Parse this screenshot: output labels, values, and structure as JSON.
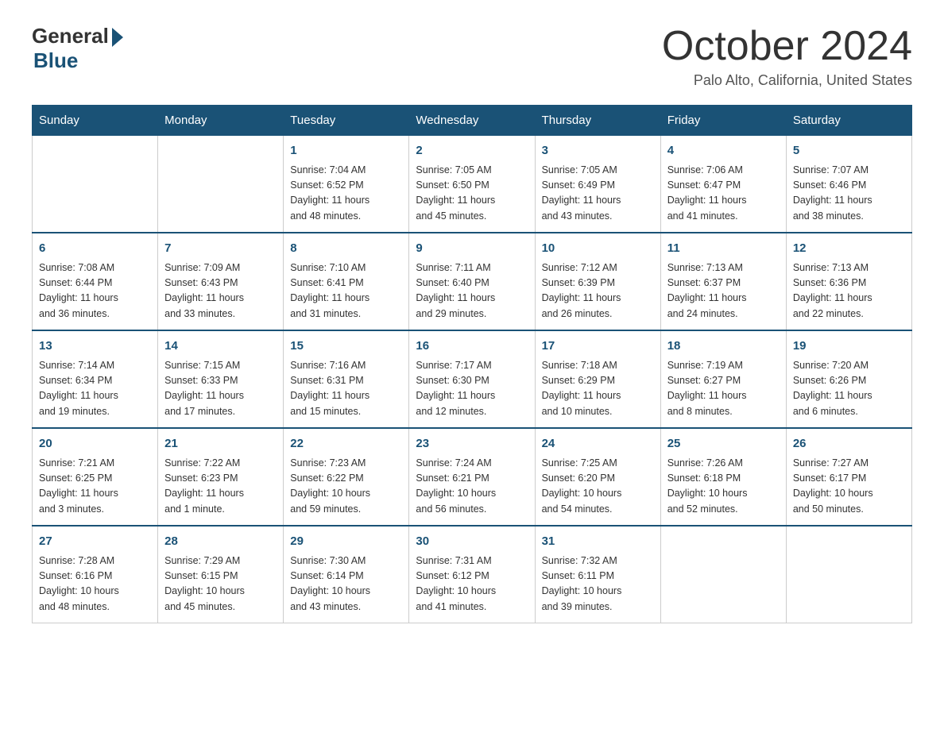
{
  "header": {
    "logo_general": "General",
    "logo_blue": "Blue",
    "month_title": "October 2024",
    "location": "Palo Alto, California, United States"
  },
  "days_of_week": [
    "Sunday",
    "Monday",
    "Tuesday",
    "Wednesday",
    "Thursday",
    "Friday",
    "Saturday"
  ],
  "weeks": [
    [
      {
        "day": "",
        "info": ""
      },
      {
        "day": "",
        "info": ""
      },
      {
        "day": "1",
        "info": "Sunrise: 7:04 AM\nSunset: 6:52 PM\nDaylight: 11 hours\nand 48 minutes."
      },
      {
        "day": "2",
        "info": "Sunrise: 7:05 AM\nSunset: 6:50 PM\nDaylight: 11 hours\nand 45 minutes."
      },
      {
        "day": "3",
        "info": "Sunrise: 7:05 AM\nSunset: 6:49 PM\nDaylight: 11 hours\nand 43 minutes."
      },
      {
        "day": "4",
        "info": "Sunrise: 7:06 AM\nSunset: 6:47 PM\nDaylight: 11 hours\nand 41 minutes."
      },
      {
        "day": "5",
        "info": "Sunrise: 7:07 AM\nSunset: 6:46 PM\nDaylight: 11 hours\nand 38 minutes."
      }
    ],
    [
      {
        "day": "6",
        "info": "Sunrise: 7:08 AM\nSunset: 6:44 PM\nDaylight: 11 hours\nand 36 minutes."
      },
      {
        "day": "7",
        "info": "Sunrise: 7:09 AM\nSunset: 6:43 PM\nDaylight: 11 hours\nand 33 minutes."
      },
      {
        "day": "8",
        "info": "Sunrise: 7:10 AM\nSunset: 6:41 PM\nDaylight: 11 hours\nand 31 minutes."
      },
      {
        "day": "9",
        "info": "Sunrise: 7:11 AM\nSunset: 6:40 PM\nDaylight: 11 hours\nand 29 minutes."
      },
      {
        "day": "10",
        "info": "Sunrise: 7:12 AM\nSunset: 6:39 PM\nDaylight: 11 hours\nand 26 minutes."
      },
      {
        "day": "11",
        "info": "Sunrise: 7:13 AM\nSunset: 6:37 PM\nDaylight: 11 hours\nand 24 minutes."
      },
      {
        "day": "12",
        "info": "Sunrise: 7:13 AM\nSunset: 6:36 PM\nDaylight: 11 hours\nand 22 minutes."
      }
    ],
    [
      {
        "day": "13",
        "info": "Sunrise: 7:14 AM\nSunset: 6:34 PM\nDaylight: 11 hours\nand 19 minutes."
      },
      {
        "day": "14",
        "info": "Sunrise: 7:15 AM\nSunset: 6:33 PM\nDaylight: 11 hours\nand 17 minutes."
      },
      {
        "day": "15",
        "info": "Sunrise: 7:16 AM\nSunset: 6:31 PM\nDaylight: 11 hours\nand 15 minutes."
      },
      {
        "day": "16",
        "info": "Sunrise: 7:17 AM\nSunset: 6:30 PM\nDaylight: 11 hours\nand 12 minutes."
      },
      {
        "day": "17",
        "info": "Sunrise: 7:18 AM\nSunset: 6:29 PM\nDaylight: 11 hours\nand 10 minutes."
      },
      {
        "day": "18",
        "info": "Sunrise: 7:19 AM\nSunset: 6:27 PM\nDaylight: 11 hours\nand 8 minutes."
      },
      {
        "day": "19",
        "info": "Sunrise: 7:20 AM\nSunset: 6:26 PM\nDaylight: 11 hours\nand 6 minutes."
      }
    ],
    [
      {
        "day": "20",
        "info": "Sunrise: 7:21 AM\nSunset: 6:25 PM\nDaylight: 11 hours\nand 3 minutes."
      },
      {
        "day": "21",
        "info": "Sunrise: 7:22 AM\nSunset: 6:23 PM\nDaylight: 11 hours\nand 1 minute."
      },
      {
        "day": "22",
        "info": "Sunrise: 7:23 AM\nSunset: 6:22 PM\nDaylight: 10 hours\nand 59 minutes."
      },
      {
        "day": "23",
        "info": "Sunrise: 7:24 AM\nSunset: 6:21 PM\nDaylight: 10 hours\nand 56 minutes."
      },
      {
        "day": "24",
        "info": "Sunrise: 7:25 AM\nSunset: 6:20 PM\nDaylight: 10 hours\nand 54 minutes."
      },
      {
        "day": "25",
        "info": "Sunrise: 7:26 AM\nSunset: 6:18 PM\nDaylight: 10 hours\nand 52 minutes."
      },
      {
        "day": "26",
        "info": "Sunrise: 7:27 AM\nSunset: 6:17 PM\nDaylight: 10 hours\nand 50 minutes."
      }
    ],
    [
      {
        "day": "27",
        "info": "Sunrise: 7:28 AM\nSunset: 6:16 PM\nDaylight: 10 hours\nand 48 minutes."
      },
      {
        "day": "28",
        "info": "Sunrise: 7:29 AM\nSunset: 6:15 PM\nDaylight: 10 hours\nand 45 minutes."
      },
      {
        "day": "29",
        "info": "Sunrise: 7:30 AM\nSunset: 6:14 PM\nDaylight: 10 hours\nand 43 minutes."
      },
      {
        "day": "30",
        "info": "Sunrise: 7:31 AM\nSunset: 6:12 PM\nDaylight: 10 hours\nand 41 minutes."
      },
      {
        "day": "31",
        "info": "Sunrise: 7:32 AM\nSunset: 6:11 PM\nDaylight: 10 hours\nand 39 minutes."
      },
      {
        "day": "",
        "info": ""
      },
      {
        "day": "",
        "info": ""
      }
    ]
  ]
}
